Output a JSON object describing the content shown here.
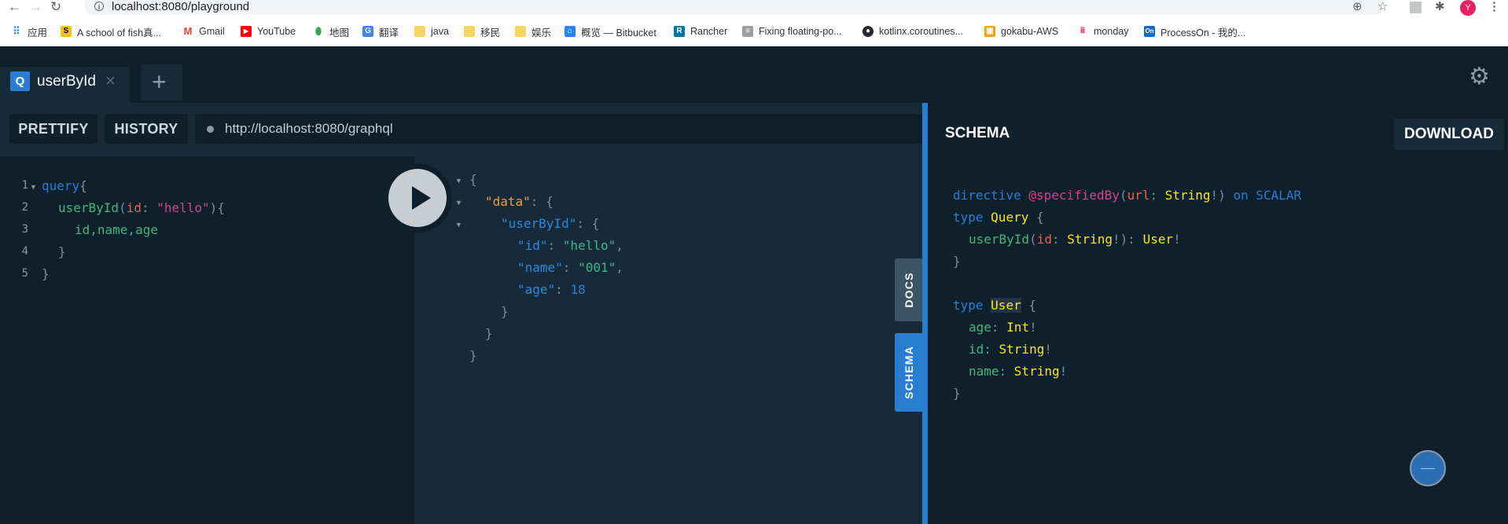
{
  "browser": {
    "url": "localhost:8080/playground",
    "avatar_letter": "Y",
    "bookmarks": [
      {
        "label": "应用"
      },
      {
        "label": "A school of fish真..."
      },
      {
        "label": "Gmail"
      },
      {
        "label": "YouTube"
      },
      {
        "label": "地图"
      },
      {
        "label": "翻译"
      },
      {
        "label": "java"
      },
      {
        "label": "移民"
      },
      {
        "label": "娱乐"
      },
      {
        "label": "概览 — Bitbucket"
      },
      {
        "label": "Rancher"
      },
      {
        "label": "Fixing floating-po..."
      },
      {
        "label": "kotlinx.coroutines..."
      },
      {
        "label": "gokabu-AWS"
      },
      {
        "label": "monday"
      },
      {
        "label": "ProcessOn - 我的..."
      }
    ]
  },
  "tabs": {
    "active": {
      "badge": "Q",
      "title": "userById",
      "close": "×"
    },
    "add": "+"
  },
  "toolbar": {
    "prettify": "PRETTIFY",
    "history": "HISTORY",
    "endpoint": "http://localhost:8080/graphql"
  },
  "query": {
    "line_numbers": [
      "1",
      "2",
      "3",
      "4",
      "5"
    ],
    "l1_kw": "query",
    "l1_brace": "{",
    "l2_field": "userById",
    "l2_paren_open": "(",
    "l2_arg": "id",
    "l2_colon": ": ",
    "l2_value": "\"hello\"",
    "l2_close": "){",
    "l3_fields": "id,name,age",
    "l4": "}",
    "l5": "}"
  },
  "result": {
    "open": "{",
    "data_key": "\"data\"",
    "user_key": "\"userById\"",
    "id_key": "\"id\"",
    "id_val": "\"hello\"",
    "name_key": "\"name\"",
    "name_val": "\"001\"",
    "age_key": "\"age\"",
    "age_val": "18",
    "colon_brace": ": {",
    "colon": ": ",
    "comma": ",",
    "close": "}"
  },
  "side_tabs": {
    "docs": "DOCS",
    "schema": "SCHEMA"
  },
  "schema": {
    "title": "SCHEMA",
    "download": "DOWNLOAD",
    "directive_kw": "directive",
    "directive_name": "@specifiedBy",
    "directive_arg": "url",
    "string_type": "String",
    "int_type": "Int",
    "bang": "!",
    "on_kw": "on",
    "scalar_kw": "SCALAR",
    "type_kw": "type",
    "query_type": "Query",
    "user_type": "User",
    "query_field": "userById",
    "query_arg": "id",
    "age_field": "age",
    "id_field": "id",
    "name_field": "name",
    "open_brace": "{",
    "close_brace": "}"
  },
  "colors": {
    "background": "#172a3a",
    "panel": "#0f202d",
    "accent": "#2a7ed2",
    "type_yellow": "#f8e71c",
    "field_green": "#47b57a",
    "directive_pink": "#d64292"
  },
  "icons": {
    "back": "back-arrow-icon",
    "forward": "forward-arrow-icon",
    "reload": "reload-icon",
    "settings": "gear-icon",
    "run": "play-icon"
  }
}
